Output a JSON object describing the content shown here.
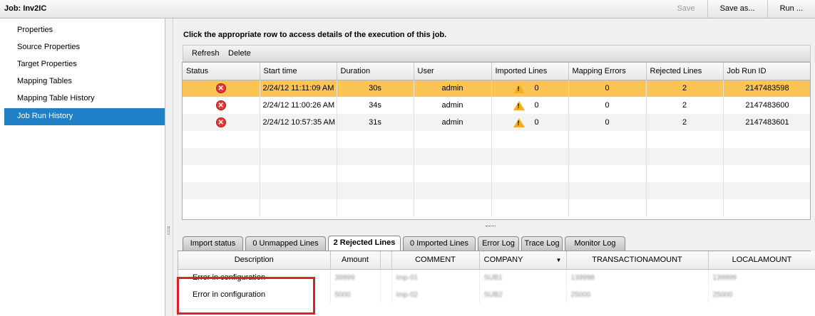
{
  "header": {
    "title": "Job: Inv2IC",
    "actions": {
      "save": "Save",
      "save_as": "Save as...",
      "run": "Run ..."
    }
  },
  "sidebar": {
    "items": [
      {
        "label": "Properties"
      },
      {
        "label": "Source Properties"
      },
      {
        "label": "Target Properties"
      },
      {
        "label": "Mapping Tables"
      },
      {
        "label": "Mapping Table History"
      },
      {
        "label": "Job Run History",
        "active": true
      }
    ]
  },
  "main": {
    "instruction": "Click the appropriate row to access details of the execution of this job.",
    "toolbar": {
      "refresh": "Refresh",
      "delete": "Delete"
    },
    "grid": {
      "columns": [
        "Status",
        "Start time",
        "Duration",
        "User",
        "Imported Lines",
        "Mapping Errors",
        "Rejected Lines",
        "Job Run ID"
      ],
      "rows": [
        {
          "start_time": "2/24/12 11:11:09 AM",
          "duration": "30s",
          "user": "admin",
          "imported": "0",
          "mapping_errors": "0",
          "rejected": "2",
          "run_id": "2147483598",
          "selected": true
        },
        {
          "start_time": "2/24/12 11:00:26 AM",
          "duration": "34s",
          "user": "admin",
          "imported": "0",
          "mapping_errors": "0",
          "rejected": "2",
          "run_id": "2147483600"
        },
        {
          "start_time": "2/24/12 10:57:35 AM",
          "duration": "31s",
          "user": "admin",
          "imported": "0",
          "mapping_errors": "0",
          "rejected": "2",
          "run_id": "2147483601"
        }
      ]
    },
    "tabs": [
      "Import status",
      "0 Unmapped Lines",
      "2 Rejected Lines",
      "0 Imported Lines",
      "Error Log",
      "Trace Log",
      "Monitor Log"
    ],
    "active_tab": "2 Rejected Lines",
    "detail": {
      "columns": [
        "Description",
        "Amount",
        "",
        "COMMENT",
        "COMPANY",
        "TRANSACTIONAMOUNT",
        "LOCALAMOUNT"
      ],
      "rows": [
        {
          "description": "Error in configuration",
          "amount": "39999",
          "comment": "imp-01",
          "company": "SUB1",
          "transaction_amount": "139998",
          "local_amount": "139999"
        },
        {
          "description": "Error in configuration",
          "amount": "5000",
          "comment": "imp-02",
          "company": "SUB2",
          "transaction_amount": "25000",
          "local_amount": "25000"
        }
      ]
    }
  },
  "colors": {
    "selection": "#fcc454",
    "nav_active": "#1f80c7",
    "highlight_box": "#e01f26",
    "error_icon": "#e03a3a",
    "warning_icon": "#f0b020"
  },
  "icons": {
    "status": "error-icon",
    "imported": "warning-icon",
    "sort": "sort-desc-icon"
  }
}
